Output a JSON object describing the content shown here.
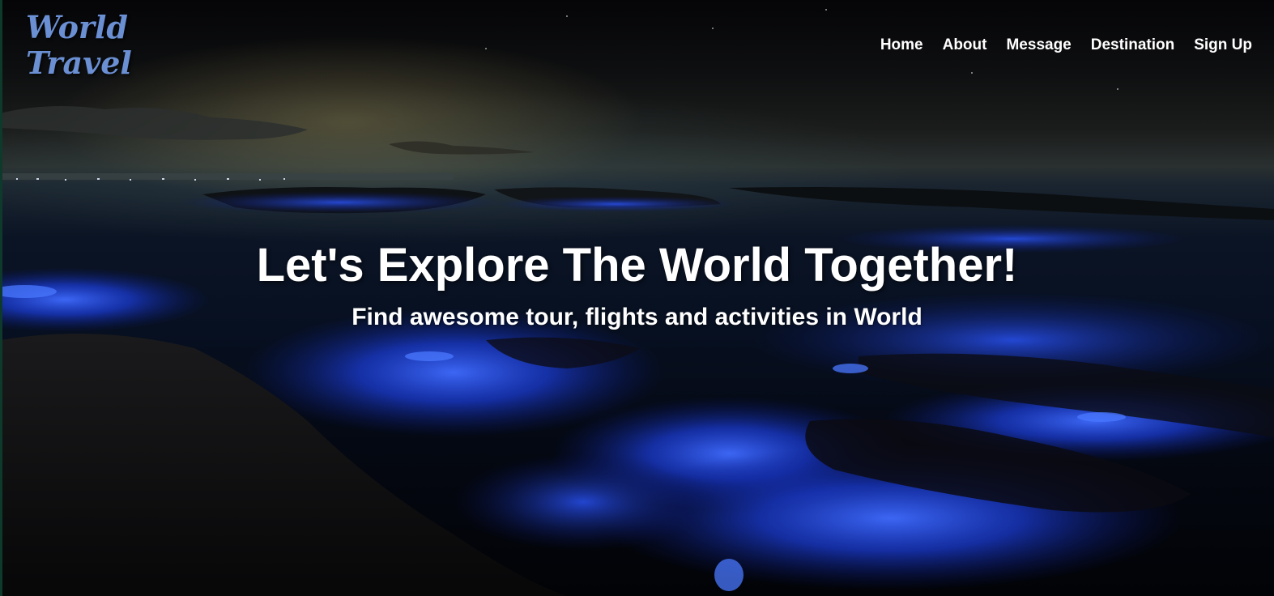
{
  "logo": {
    "line1": "World",
    "line2": "Travel"
  },
  "nav": {
    "items": [
      {
        "label": "Home"
      },
      {
        "label": "About"
      },
      {
        "label": "Message"
      },
      {
        "label": "Destination"
      },
      {
        "label": "Sign Up"
      }
    ]
  },
  "hero": {
    "title": "Let's Explore The World Together!",
    "subtitle": "Find awesome tour, flights and activities in World",
    "background_image": "night seascape with glowing blue bioluminescent shoreline"
  },
  "colors": {
    "logo": "#6b8fd3",
    "nav_text": "#ffffff",
    "glow": "#1f4dff"
  }
}
